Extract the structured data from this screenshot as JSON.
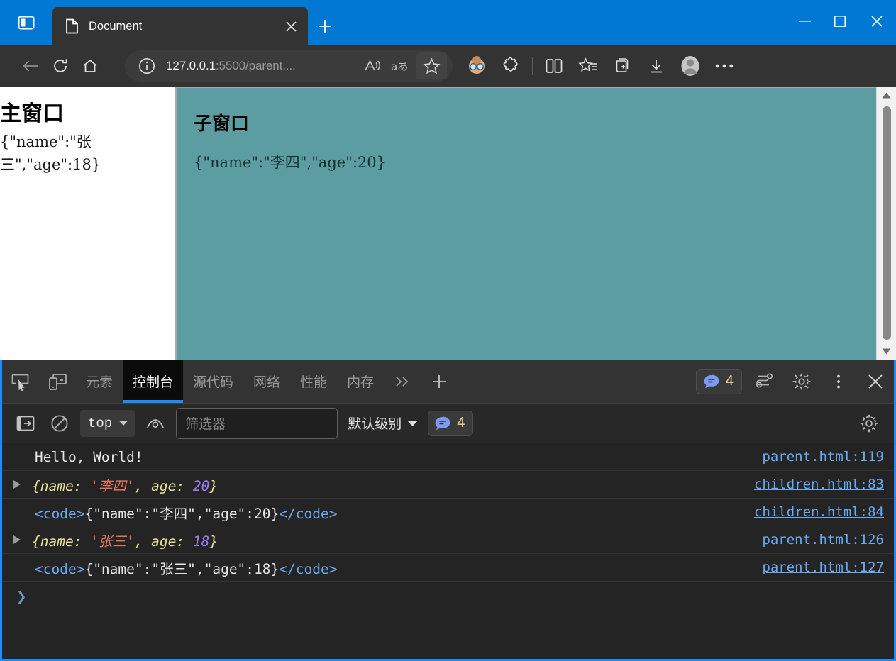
{
  "browser": {
    "window_controls": {
      "minimize": "minimize-icon",
      "maximize": "maximize-icon",
      "close": "close-icon"
    },
    "tab_search_icon": "split-pane-icon",
    "tabs": [
      {
        "title": "Document",
        "favicon": "document-icon",
        "close_label": "close-tab-icon",
        "active": true
      }
    ],
    "new_tab_label": "new-tab-icon",
    "nav": {
      "back": "back-arrow-icon",
      "refresh": "refresh-icon",
      "home": "home-icon",
      "site_info": "info-icon",
      "url_host": "127.0.0.1",
      "url_rest": ":5500/parent....",
      "url_full": "127.0.0.1:5500/parent....",
      "read_aloud": "read-aloud-icon",
      "translate": "translate-icon",
      "favorite": "star-outline-icon"
    },
    "toolbar_icons": [
      "profile-avatar-icon",
      "extensions-icon",
      "split-screen-icon",
      "favorites-icon",
      "collections-icon",
      "downloads-icon",
      "account-icon",
      "settings-more-icon"
    ]
  },
  "page": {
    "main_window": {
      "heading": "主窗口",
      "json_text": "{\"name\":\"张三\",\"age\":18}"
    },
    "child_window": {
      "heading": "子窗口",
      "json_text": "{\"name\":\"李四\",\"age\":20}",
      "background_color": "#5b9da1"
    },
    "scrollbar": {
      "up": "scroll-up-arrow-icon",
      "down": "scroll-down-arrow-icon"
    }
  },
  "devtools": {
    "accent_color": "#1a8cff",
    "left_icons": [
      "inspect-element-icon",
      "device-toolbar-icon"
    ],
    "tabs": [
      {
        "label": "元素",
        "active": false
      },
      {
        "label": "控制台",
        "active": true
      },
      {
        "label": "源代码",
        "active": false
      },
      {
        "label": "网络",
        "active": false
      },
      {
        "label": "性能",
        "active": false
      },
      {
        "label": "内存",
        "active": false
      }
    ],
    "more_tabs_icon": "chevron-double-right-icon",
    "add_panel_icon": "plus-icon",
    "issues_badge": {
      "icon": "message-bubble-icon",
      "count": "4"
    },
    "right_icons": [
      "devtools-settings-gear-icon",
      "more-options-icon",
      "close-devtools-icon"
    ],
    "customize_icon": "customize-gear-icon",
    "console_toolbar": {
      "sidebar_toggle_icon": "console-sidebar-icon",
      "clear_console_icon": "clear-console-icon",
      "context_value": "top",
      "context_chevron": "chevron-down-icon",
      "live_expression_icon": "eye-icon",
      "filter_placeholder": "筛选器",
      "filter_value": "",
      "levels_label": "默认级别",
      "levels_chevron": "chevron-down-icon",
      "badge": {
        "icon": "message-bubble-icon",
        "count": "4"
      },
      "settings_icon": "gear-icon"
    },
    "console_messages": [
      {
        "kind": "text",
        "expandable": false,
        "text": "Hello, World!",
        "source": "parent.html:119"
      },
      {
        "kind": "object",
        "expandable": true,
        "expand_icon": "triangle-right-icon",
        "prefix": "{name: ",
        "string_value": "'李四'",
        "middle": ", age: ",
        "number_value": "20",
        "suffix": "}",
        "source": "children.html:83"
      },
      {
        "kind": "html",
        "expandable": false,
        "open_tag": "<code>",
        "inner": "{\"name\":\"李四\",\"age\":20}",
        "close_tag": "</code>",
        "source": "children.html:84"
      },
      {
        "kind": "object",
        "expandable": true,
        "expand_icon": "triangle-right-icon",
        "prefix": "{name: ",
        "string_value": "'张三'",
        "middle": ", age: ",
        "number_value": "18",
        "suffix": "}",
        "source": "parent.html:126"
      },
      {
        "kind": "html",
        "expandable": false,
        "open_tag": "<code>",
        "inner": "{\"name\":\"张三\",\"age\":18}",
        "close_tag": "</code>",
        "source": "parent.html:127"
      }
    ],
    "console_prompt": {
      "chevron": "❯",
      "value": ""
    }
  }
}
